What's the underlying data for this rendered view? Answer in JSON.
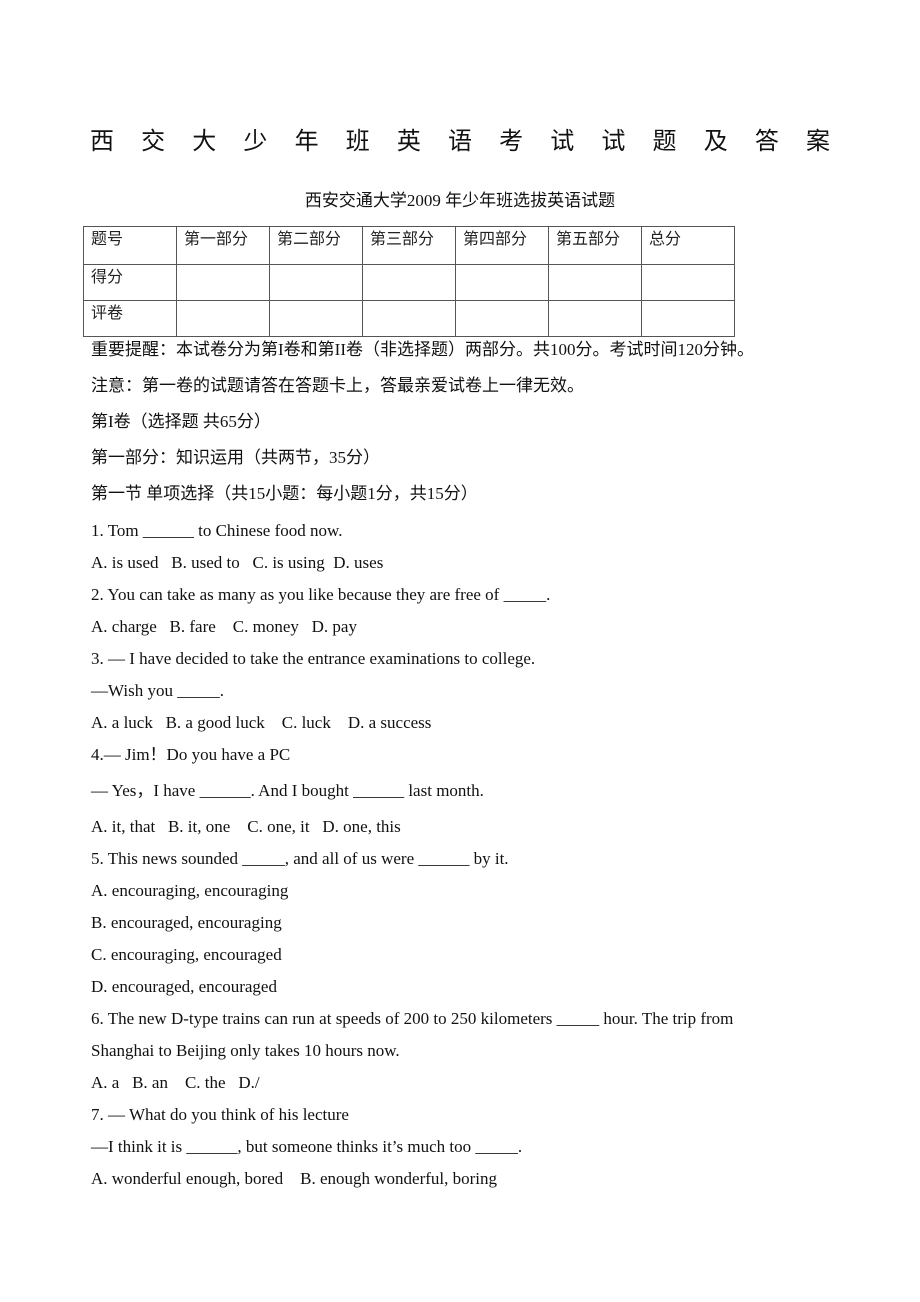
{
  "title": {
    "chars": [
      "西",
      "交",
      "大",
      "少",
      "年",
      "班",
      "英",
      "语",
      "考",
      "试",
      "试",
      "题",
      "及",
      "答",
      "案"
    ]
  },
  "subtitle": "西安交通大学2009 年少年班选拔英语试题",
  "score_table": {
    "header": [
      "题号",
      "第一部分",
      "第二部分",
      "第三部分",
      "第四部分",
      "第五部分",
      "总分"
    ],
    "rows": [
      [
        "得分",
        "",
        "",
        "",
        "",
        "",
        ""
      ],
      [
        "评卷",
        "",
        "",
        "",
        "",
        "",
        ""
      ]
    ]
  },
  "instructions": [
    "重要提醒：本试卷分为第I卷和第II卷（非选择题）两部分。共100分。考试时间120分钟。",
    "注意：第一卷的试题请答在答题卡上，答最亲爱试卷上一律无效。",
    "第I卷（选择题 共65分）",
    "第一部分：知识运用（共两节，35分）",
    "第一节 单项选择（共15小题：每小题1分，共15分）"
  ],
  "questions": [
    {
      "text": "1. Tom ______ to Chinese food now.",
      "options": [
        "A. is used   B. used to   C. is using  D. uses"
      ]
    },
    {
      "text": "2. You can take as many as you like because they are free of _____.",
      "options": [
        "A. charge   B. fare    C. money   D. pay"
      ]
    },
    {
      "text": "3. — I have decided to take the entrance examinations to college.",
      "extra": "—Wish you _____.",
      "options": [
        "A. a luck   B. a good luck    C. luck    D. a success"
      ]
    },
    {
      "text": "4.— Jim！Do you have a PC",
      "extra": "— Yes，I have ______. And I bought ______ last month.",
      "options": [
        "A. it, that   B. it, one    C. one, it   D. one, this"
      ]
    },
    {
      "text": "5. This news sounded _____, and all of us were ______ by it.",
      "options": [
        "A. encouraging, encouraging",
        "B. encouraged, encouraging",
        "C. encouraging, encouraged",
        "D. encouraged, encouraged"
      ]
    },
    {
      "text": "6. The new D-type trains can run at speeds of 200 to 250 kilometers _____ hour. The trip from",
      "extra": "Shanghai to Beijing only takes 10 hours now.",
      "options": [
        "A. a   B. an    C. the   D./"
      ]
    },
    {
      "text": "7. — What do you think of his lecture",
      "extra": "—I think it is ______, but someone thinks it’s much too _____.",
      "options": [
        "A. wonderful enough, bored    B. enough wonderful, boring"
      ]
    }
  ]
}
